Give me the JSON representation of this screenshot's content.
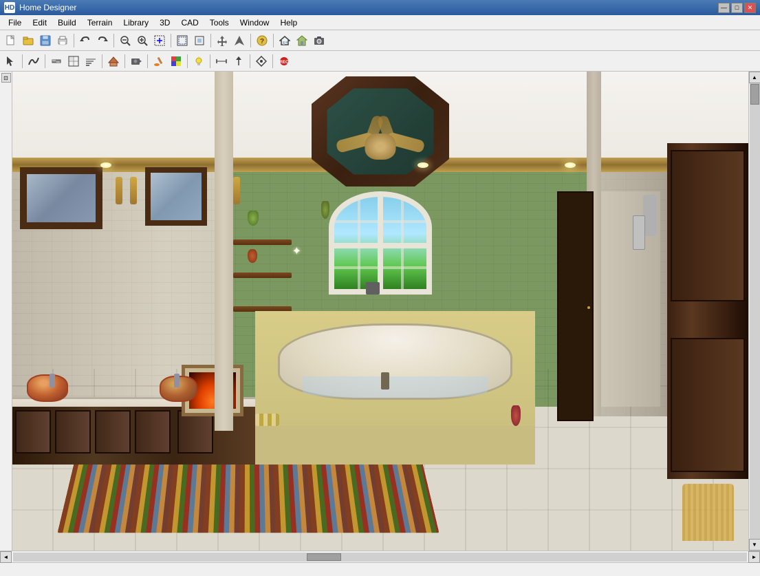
{
  "window": {
    "title": "Home Designer",
    "icon": "HD"
  },
  "titlebar": {
    "controls": {
      "minimize": "—",
      "maximize": "□",
      "close": "✕"
    }
  },
  "menubar": {
    "items": [
      "File",
      "Edit",
      "Build",
      "Terrain",
      "Library",
      "3D",
      "CAD",
      "Tools",
      "Window",
      "Help"
    ]
  },
  "toolbar1": {
    "buttons": [
      {
        "name": "new",
        "icon": "📄"
      },
      {
        "name": "open",
        "icon": "📂"
      },
      {
        "name": "save",
        "icon": "💾"
      },
      {
        "name": "print",
        "icon": "🖨"
      },
      {
        "name": "undo",
        "icon": "↩"
      },
      {
        "name": "redo",
        "icon": "↪"
      },
      {
        "name": "zoom-out",
        "icon": "🔍"
      },
      {
        "name": "zoom-in-box",
        "icon": "⊕"
      },
      {
        "name": "zoom-out-btn",
        "icon": "⊖"
      },
      {
        "name": "fill-window",
        "icon": "⊞"
      },
      {
        "name": "select-all",
        "icon": "⊡"
      },
      {
        "name": "move",
        "icon": "⊕"
      },
      {
        "name": "arrow-up",
        "icon": "↑"
      },
      {
        "name": "shape1",
        "icon": "△"
      },
      {
        "name": "puzzle",
        "icon": "⊕"
      },
      {
        "name": "help",
        "icon": "?"
      },
      {
        "name": "house",
        "icon": "⌂"
      },
      {
        "name": "house2",
        "icon": "⌂"
      },
      {
        "name": "camera",
        "icon": "📷"
      }
    ]
  },
  "toolbar2": {
    "buttons": [
      {
        "name": "select",
        "icon": "↖"
      },
      {
        "name": "spline",
        "icon": "∿"
      },
      {
        "name": "wall",
        "icon": "⊞"
      },
      {
        "name": "floor",
        "icon": "▦"
      },
      {
        "name": "stairs",
        "icon": "▤"
      },
      {
        "name": "room",
        "icon": "⊟"
      },
      {
        "name": "roof",
        "icon": "△"
      },
      {
        "name": "camera-tool",
        "icon": "📷"
      },
      {
        "name": "paint",
        "icon": "🖌"
      },
      {
        "name": "gradient",
        "icon": "▓"
      },
      {
        "name": "light",
        "icon": "💡"
      },
      {
        "name": "dimension",
        "icon": "⊣"
      },
      {
        "name": "arrow",
        "icon": "↑"
      },
      {
        "name": "move-tool",
        "icon": "✛"
      },
      {
        "name": "record",
        "icon": "⏺"
      }
    ]
  },
  "statusbar": {
    "text": ""
  },
  "scene": {
    "description": "3D bathroom render with octagonal ceiling, ceiling fan, vanity, bathtub, window, and decorative elements"
  }
}
